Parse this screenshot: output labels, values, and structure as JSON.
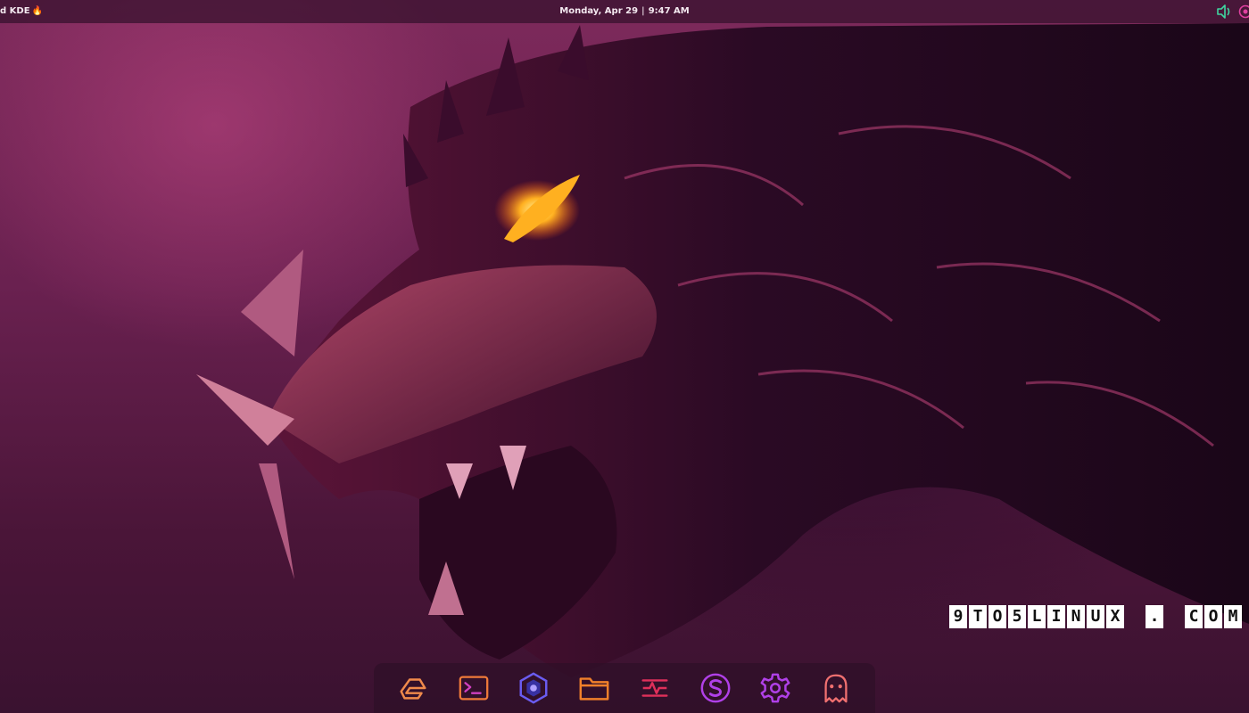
{
  "top_panel": {
    "app_title": "d KDE",
    "app_title_glyph": "🔥",
    "date": "Monday, Apr 29",
    "separator": "|",
    "time": "9:47 AM",
    "tray_icons": [
      "speaker-icon",
      "notification-icon"
    ]
  },
  "watermark": {
    "text": "9TO5LINUX.COM",
    "chars": [
      "9",
      "T",
      "O",
      "5",
      "L",
      "I",
      "N",
      "U",
      "X",
      "",
      ".",
      "",
      "C",
      "O",
      "M"
    ]
  },
  "dock": {
    "items": [
      {
        "icon": "garuda-icon",
        "color": "#f08a4b"
      },
      {
        "icon": "terminal-icon",
        "color": "#f07a3a"
      },
      {
        "icon": "hexagon-app-icon",
        "color": "#6a5cf0"
      },
      {
        "icon": "folder-icon",
        "color": "#f0802a"
      },
      {
        "icon": "system-monitor-icon",
        "color": "#e0305a"
      },
      {
        "icon": "s-app-icon",
        "color": "#b040e8"
      },
      {
        "icon": "settings-icon",
        "color": "#b040e8"
      },
      {
        "icon": "ghost-icon",
        "color": "#f07070"
      }
    ]
  },
  "colors": {
    "background": "#6a2150",
    "panel": "#37122d",
    "eye": "#ffb020"
  }
}
